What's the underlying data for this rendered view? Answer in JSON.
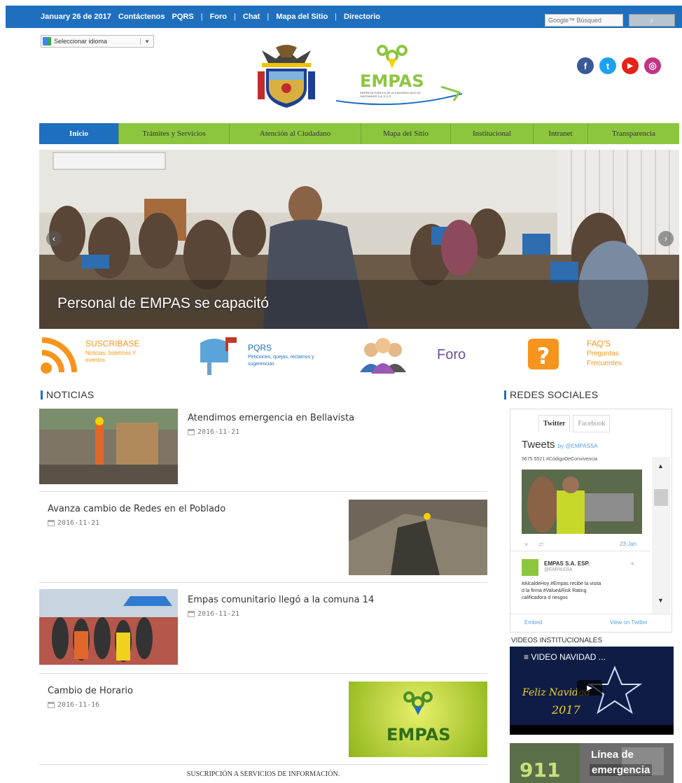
{
  "topbar": {
    "date": "January 26 de 2017",
    "links": [
      "Contáctenos",
      "PQRS",
      "Foro",
      "Chat",
      "Mapa del Sitio",
      "Directorio"
    ],
    "search_placeholder": "Google™ Búsqued",
    "search_button": "⌕"
  },
  "language": {
    "label": "Seleccionar idioma",
    "caret": "▼"
  },
  "social": [
    {
      "icon": "facebook-icon",
      "glyph": "f",
      "color": "#3b5998"
    },
    {
      "icon": "twitter-icon",
      "glyph": "t",
      "color": "#1da1f2"
    },
    {
      "icon": "youtube-icon",
      "glyph": "▶",
      "color": "#e62117"
    },
    {
      "icon": "instagram-icon",
      "glyph": "◎",
      "color": "#c13584"
    }
  ],
  "logo": {
    "brand": "EMPAS",
    "tagline": "EMPRESA PUBLICA DE ALCANTARILLADO DE SANTANDER S.A. E.S.P."
  },
  "nav": [
    "Inicio",
    "Trámites y Servicios",
    "Atención al Ciudadano",
    "Mapa del Sitio",
    "Institucional",
    "Intranet",
    "Transparencia"
  ],
  "hero": {
    "caption": "Personal de EMPAS se capacitó"
  },
  "quicklinks": {
    "suscribase": {
      "title": "SUSCRIBASE",
      "sub": "Noticias, boletines Y eventos"
    },
    "pqrs": {
      "title": "PQRS",
      "sub": "Peticiones, quejas, reclamos y sugerencias"
    },
    "foro": {
      "title": "Foro"
    },
    "faq": {
      "title": "FAQ'S",
      "sub1": "Preguntas",
      "sub2": "Frecuentes"
    }
  },
  "noticias": {
    "title": "NOTICIAS",
    "items": [
      {
        "title": "Atendimos emergencia en Bellavista",
        "date": "2016-11-21"
      },
      {
        "title": "Avanza cambio de Redes en el Poblado",
        "date": "2016-11-21"
      },
      {
        "title": "Empas comunitario llegó a la comuna 14",
        "date": "2016-11-21"
      },
      {
        "title": "Cambio de Horario",
        "date": "2016-11-16"
      }
    ]
  },
  "redes": {
    "title": "REDES SOCIALES",
    "tabs": [
      "Twitter",
      "Facebook"
    ],
    "tweets_label": "Tweets",
    "by": "by @EMPASSA",
    "line1": "5675 5521 #CódigoDeConvivencia",
    "date": "23 Jan",
    "account": "EMPAS S.A. ESP.",
    "handle": "@EMPASSA",
    "tweet_text": [
      "#AlcaldeHoy #Empas recibe la visita",
      "d la firma #Value&Risk Rating",
      "calificadora d riesgos"
    ],
    "embed": "Embed",
    "view": "View on Twitter"
  },
  "videos": {
    "title": "VIDEOS INSTITUCIONALES",
    "label": "VIDEO NAVIDAD ..."
  },
  "emergencia": {
    "number": "911",
    "line1": "Línea de",
    "line2": "emergencia"
  },
  "footer": {
    "subscribe": "SUSCRIPCIÓN A SERVICIOS DE INFORMACIÓN."
  }
}
